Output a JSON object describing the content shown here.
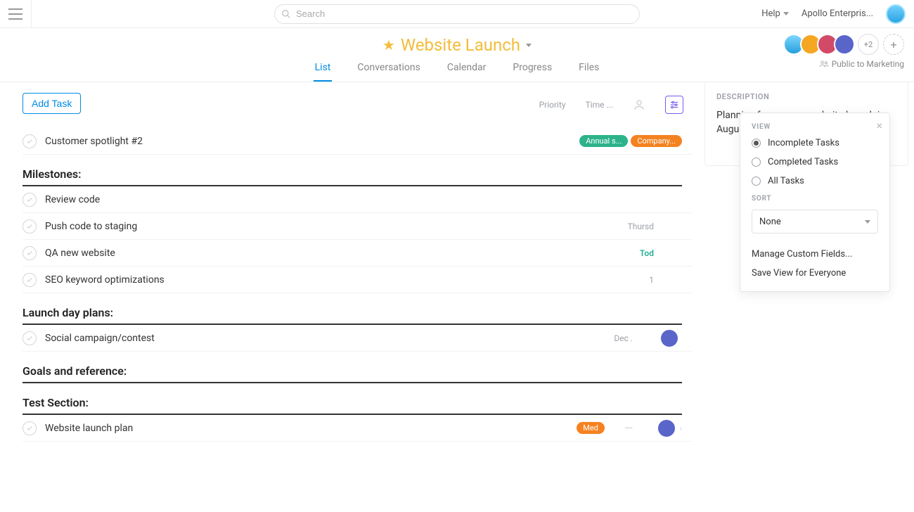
{
  "search": {
    "placeholder": "Search"
  },
  "topbar": {
    "help_label": "Help",
    "workspace_label": "Apollo Enterpris..."
  },
  "project": {
    "title": "Website Launch",
    "privacy": "Public to Marketing",
    "extra_members_label": "+2",
    "description_heading": "DESCRIPTION",
    "description": "Planning for our new website launch in August."
  },
  "tabs": [
    {
      "id": "list",
      "label": "List",
      "active": true
    },
    {
      "id": "conversations",
      "label": "Conversations",
      "active": false
    },
    {
      "id": "calendar",
      "label": "Calendar",
      "active": false
    },
    {
      "id": "progress",
      "label": "Progress",
      "active": false
    },
    {
      "id": "files",
      "label": "Files",
      "active": false
    }
  ],
  "toolbar": {
    "add_task": "Add Task"
  },
  "columns": {
    "priority": "Priority",
    "time": "Time ..."
  },
  "tasks_top": [
    {
      "title": "Customer spotlight #2",
      "tags": [
        {
          "text": "Annual s...",
          "color": "green"
        },
        {
          "text": "Company...",
          "color": "orange"
        }
      ]
    }
  ],
  "sections": [
    {
      "name": "Milestones:",
      "tasks": [
        {
          "title": "Review code",
          "due": "",
          "due_style": "grey"
        },
        {
          "title": "Push code to staging",
          "due": "Thursd",
          "due_style": "grey"
        },
        {
          "title": "QA new website",
          "due": "Tod",
          "due_style": "today"
        },
        {
          "title": "SEO keyword optimizations",
          "due": "1",
          "due_style": "grey"
        }
      ]
    },
    {
      "name": "Launch day plans:",
      "tasks": [
        {
          "title": "Social campaign/contest",
          "due": "Dec .",
          "due_style": "grey",
          "has_avatar": true
        }
      ]
    },
    {
      "name": "Goals and reference:",
      "tasks": []
    },
    {
      "name": "Test Section:",
      "tasks": [
        {
          "title": "Website launch plan",
          "due": "",
          "priority_tag": "Med",
          "dash": true,
          "has_avatar": true,
          "has_chevron": true
        }
      ]
    }
  ],
  "filter_popover": {
    "view_label": "VIEW",
    "options": [
      {
        "label": "Incomplete Tasks",
        "selected": true
      },
      {
        "label": "Completed Tasks",
        "selected": false
      },
      {
        "label": "All Tasks",
        "selected": false
      }
    ],
    "sort_label": "SORT",
    "sort_value": "None",
    "manage_fields": "Manage Custom Fields...",
    "save_view": "Save View for Everyone"
  }
}
